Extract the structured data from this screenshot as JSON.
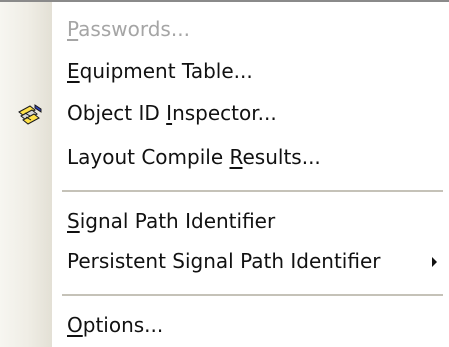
{
  "menu": {
    "items": [
      {
        "label_underline": "P",
        "label_rest": "asswords...",
        "disabled": true
      },
      {
        "label_underline": "E",
        "label_rest": "quipment Table...",
        "disabled": false
      },
      {
        "label_before": "Object ID ",
        "label_underline": "I",
        "label_rest": "nspector...",
        "icon": "object-id-inspector-icon",
        "disabled": false
      },
      {
        "label_before": "Layout Compile ",
        "label_underline": "R",
        "label_rest": "esults...",
        "disabled": false
      },
      {
        "label_underline": "S",
        "label_rest": "ignal Path Identifier",
        "disabled": false
      },
      {
        "label": "Persistent Signal Path Identifier",
        "submenu": true,
        "disabled": false
      },
      {
        "label_underline": "O",
        "label_rest": "ptions...",
        "disabled": false
      }
    ]
  },
  "colors": {
    "text": "#111111",
    "disabled_text": "#a5a5a5",
    "separator": "#c5c2b8",
    "gutter": "#efede5"
  }
}
